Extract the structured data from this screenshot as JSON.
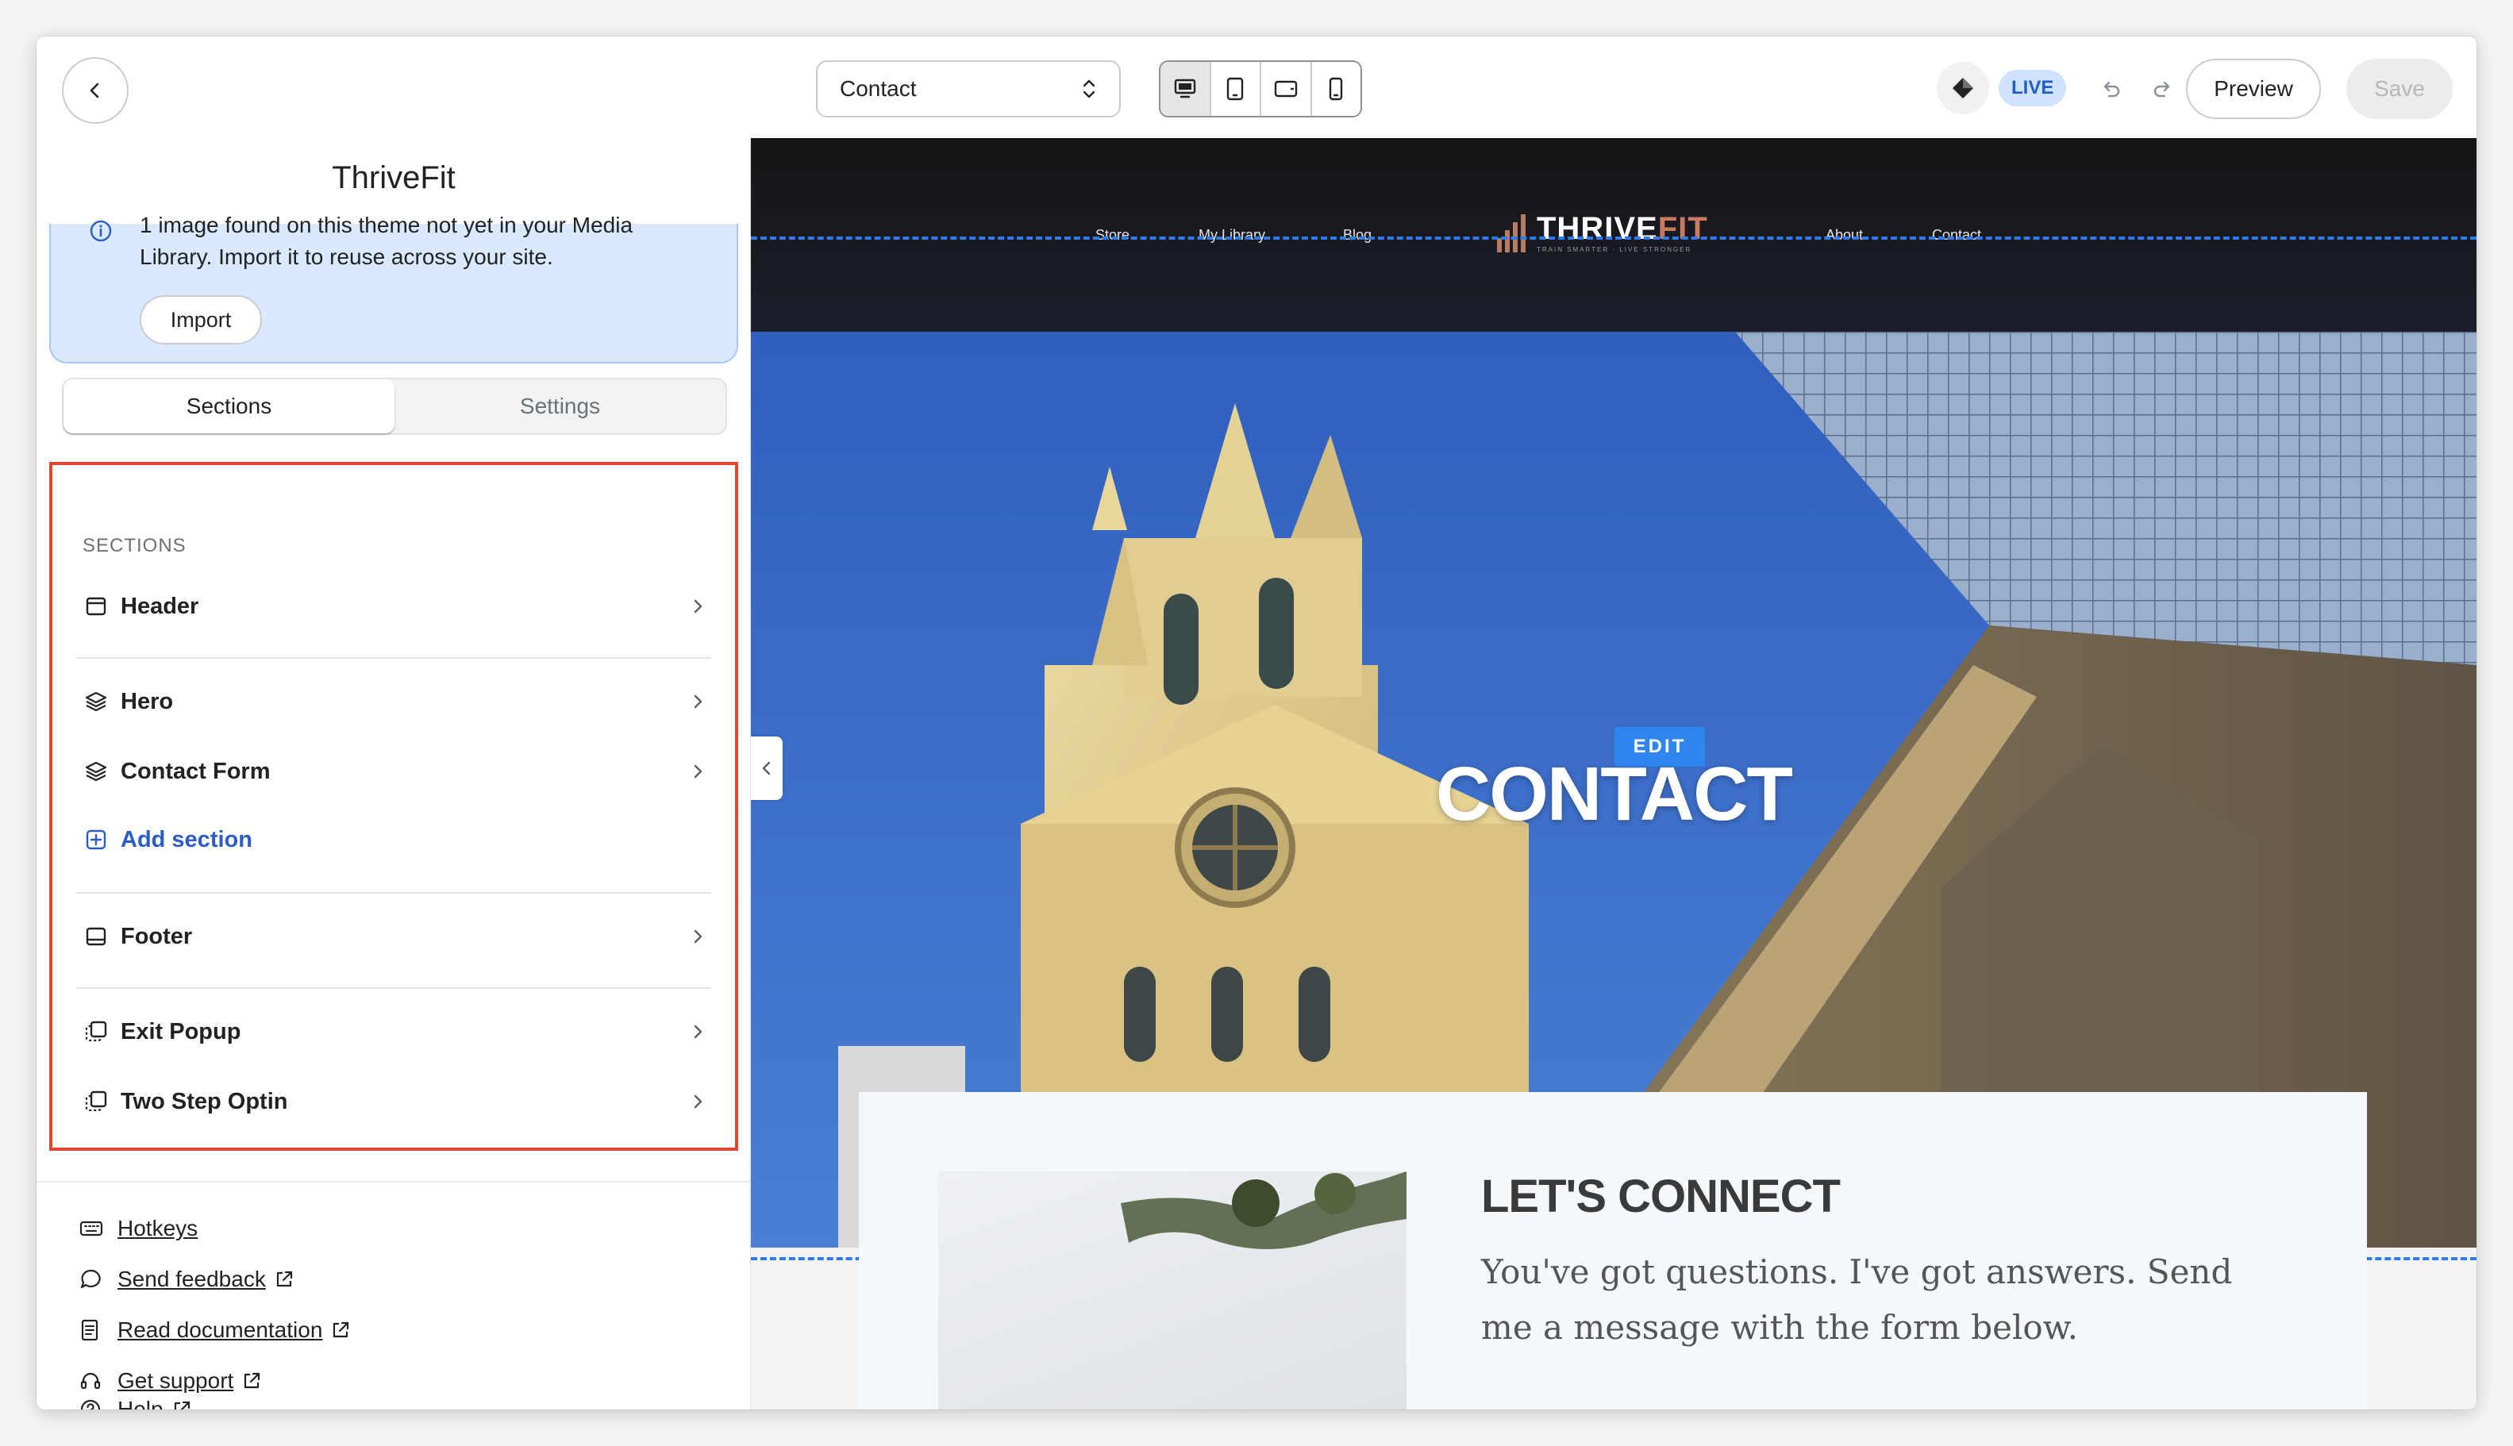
{
  "topbar": {
    "page_select": "Contact",
    "live_badge": "LIVE",
    "preview_label": "Preview",
    "save_label": "Save"
  },
  "sidebar": {
    "site_title": "ThriveFit",
    "banner": {
      "text": "1 image found on this theme not yet in your Media Library. Import it to reuse across your site.",
      "import_label": "Import"
    },
    "tabs": [
      {
        "label": "Sections"
      },
      {
        "label": "Settings"
      }
    ],
    "sections_heading": "SECTIONS",
    "sections": [
      {
        "label": "Header",
        "icon": "header-layout-icon"
      },
      {
        "label": "Hero",
        "icon": "layers-icon"
      },
      {
        "label": "Contact Form",
        "icon": "layers-icon"
      },
      {
        "label": "Add section",
        "icon": "plus-square-icon"
      },
      {
        "label": "Footer",
        "icon": "footer-layout-icon"
      },
      {
        "label": "Exit Popup",
        "icon": "popup-icon"
      },
      {
        "label": "Two Step Optin",
        "icon": "popup-icon"
      }
    ],
    "links": [
      {
        "label": "Hotkeys",
        "icon": "keyboard-icon"
      },
      {
        "label": "Send feedback",
        "icon": "chat-bubble-icon"
      },
      {
        "label": "Read documentation",
        "icon": "document-icon"
      },
      {
        "label": "Get support",
        "icon": "headset-icon"
      },
      {
        "label": "Help",
        "icon": "question-circle-icon"
      }
    ]
  },
  "canvas": {
    "nav": [
      "Store",
      "My Library",
      "Blog",
      "About",
      "Contact"
    ],
    "logo": {
      "text_main": "THRIVE",
      "text_accent": "FIT",
      "tagline": "TRAIN SMARTER · LIVE STRONGER"
    },
    "edit_badge": "EDIT",
    "hero_title": "CONTACT",
    "connect": {
      "title": "LET'S CONNECT",
      "text": "You've got questions. I've got answers. Send me a message with the form below."
    }
  },
  "colors": {
    "accent_blue": "#2f86ee",
    "highlight_red": "#e5452c",
    "dash_blue": "#2f7bea",
    "logo_accent": "#c77a5e"
  }
}
